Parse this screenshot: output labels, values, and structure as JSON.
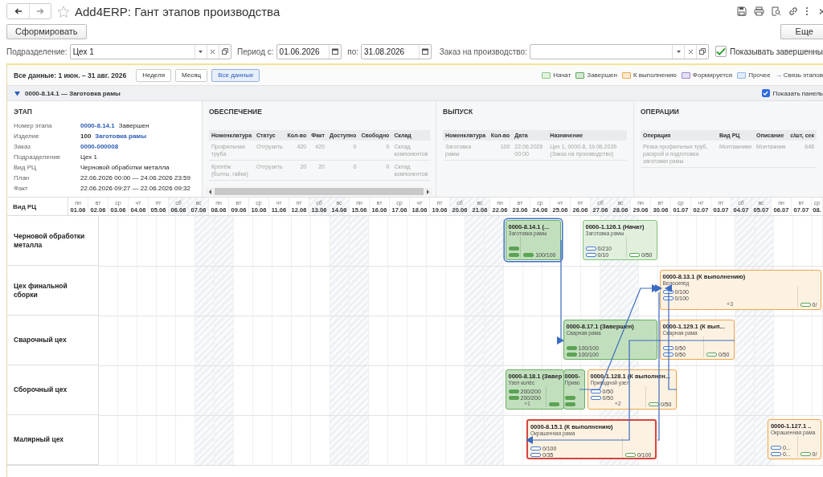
{
  "nav": {
    "title": "Add4ERP: Гант этапов производства",
    "favorite": false
  },
  "actions": {
    "generate": "Сформировать",
    "more": "Еще"
  },
  "filters": {
    "division_label": "Подразделение:",
    "division": "Цех 1",
    "period_from_label": "Период с:",
    "period_from": "01.06.2026",
    "period_to_label": "по:",
    "period_to": "31.08.2026",
    "order_label": "Заказ на производство:",
    "show_completed": {
      "label": "Показывать завершенны",
      "checked": true
    }
  },
  "toolbar": {
    "range": "Все данные: 1 июн. – 31 авг. 2026",
    "scales": [
      {
        "label": "Неделя",
        "selected": false
      },
      {
        "label": "Месяц",
        "selected": false
      },
      {
        "label": "Все данные",
        "selected": true
      }
    ],
    "legend": [
      {
        "label": "Начат",
        "color": "#8cc985"
      },
      {
        "label": "Завершен",
        "color": "#5fa85a"
      },
      {
        "label": "К выполнению",
        "color": "#f0a54a"
      },
      {
        "label": "Формируется",
        "color": "#9a85d0"
      },
      {
        "label": "Прочее",
        "color": "#8fb8e8"
      }
    ],
    "link_arrow": "→",
    "link_label": "Связь этапов"
  },
  "stage_header": {
    "title": "0000-8.14.1 — Заготовка рамы",
    "expanded": true,
    "show_panel": {
      "label": "Показать панель",
      "checked": true
    }
  },
  "details": {
    "stage": {
      "title": "ЭТАП",
      "fields": [
        {
          "label": "Номер этапа",
          "parts": [
            {
              "text": "0000-8.14.1",
              "kind": "link"
            },
            {
              "text": "Завершен",
              "kind": "plain"
            }
          ]
        },
        {
          "label": "Изделие",
          "parts": [
            {
              "text": "100",
              "kind": "bold"
            },
            {
              "text": "Заготовка рамы",
              "kind": "link"
            }
          ]
        },
        {
          "label": "Заказ",
          "parts": [
            {
              "text": "0000-000008",
              "kind": "link"
            }
          ]
        },
        {
          "label": "Подразделение",
          "parts": [
            {
              "text": "Цех 1",
              "kind": "plain"
            }
          ]
        },
        {
          "label": "Вид РЦ",
          "parts": [
            {
              "text": "Черновой обработки металла",
              "kind": "plain"
            }
          ]
        },
        {
          "label": "План",
          "parts": [
            {
              "text": "22.06.2026 00:00 — 24.06.2026 23:59",
              "kind": "plain"
            }
          ]
        },
        {
          "label": "Факт",
          "parts": [
            {
              "text": "22.06.2026 09:27 — 22.06.2026 09:32",
              "kind": "plain"
            }
          ]
        }
      ]
    },
    "supply": {
      "title": "ОБЕСПЕЧЕНИЕ",
      "columns": [
        {
          "label": "Номенклатура",
          "kind": "text"
        },
        {
          "label": "Статус",
          "kind": "text"
        },
        {
          "label": "Кол-во",
          "kind": "num"
        },
        {
          "label": "Факт",
          "kind": "num"
        },
        {
          "label": "Доступно",
          "kind": "num"
        },
        {
          "label": "Свободно",
          "kind": "num"
        },
        {
          "label": "Склад",
          "kind": "text"
        }
      ],
      "rows": [
        [
          "Профильная труба",
          "Отгрузить",
          "420",
          "420",
          "0",
          "0",
          "Склад компонентов"
        ],
        [
          "Крепёж (болты, гайки)",
          "Отгрузить",
          "20",
          "20",
          "0",
          "0",
          "Склад компонентов"
        ]
      ]
    },
    "output": {
      "title": "ВЫПУСК",
      "columns": [
        {
          "label": "Номенклатура",
          "kind": "text"
        },
        {
          "label": "Кол-во",
          "kind": "num"
        },
        {
          "label": "Дата",
          "kind": "text"
        },
        {
          "label": "Назначение",
          "kind": "text"
        }
      ],
      "rows": [
        [
          "Заготовка рамы",
          "100",
          "22.06.2026 00:00",
          "Цех 1, 0000-8, 19.06.2026 (Заказ на производство)"
        ]
      ]
    },
    "operations": {
      "title": "ОПЕРАЦИИ",
      "columns": [
        {
          "label": "Операция",
          "kind": "text"
        },
        {
          "label": "Вид РЦ",
          "kind": "text"
        },
        {
          "label": "Описание",
          "kind": "text"
        },
        {
          "label": "с/шт, сек",
          "kind": "num"
        }
      ],
      "rows": [
        [
          "Резка профильных труб, раскрой и подготовка заготовки рамы",
          "Монтажники",
          "Монтажник",
          "648"
        ]
      ]
    }
  },
  "gantt": {
    "row_header": "Вид РЦ",
    "days": [
      {
        "wd": "пн",
        "date": "01.06",
        "weekend": false
      },
      {
        "wd": "вт",
        "date": "02.06",
        "weekend": false
      },
      {
        "wd": "ср",
        "date": "03.06",
        "weekend": false
      },
      {
        "wd": "чт",
        "date": "04.06",
        "weekend": false
      },
      {
        "wd": "пт",
        "date": "05.06",
        "weekend": false
      },
      {
        "wd": "сб",
        "date": "06.06",
        "weekend": true
      },
      {
        "wd": "вс",
        "date": "07.06",
        "weekend": true
      },
      {
        "wd": "пн",
        "date": "08.06",
        "weekend": false
      },
      {
        "wd": "вт",
        "date": "09.06",
        "weekend": false
      },
      {
        "wd": "ср",
        "date": "10.06",
        "weekend": false
      },
      {
        "wd": "чт",
        "date": "11.06",
        "weekend": false
      },
      {
        "wd": "пт",
        "date": "12.06",
        "weekend": false
      },
      {
        "wd": "сб",
        "date": "13.06",
        "weekend": true
      },
      {
        "wd": "вс",
        "date": "14.06",
        "weekend": true
      },
      {
        "wd": "пн",
        "date": "15.06",
        "weekend": false
      },
      {
        "wd": "вт",
        "date": "16.06",
        "weekend": false
      },
      {
        "wd": "ср",
        "date": "17.06",
        "weekend": false
      },
      {
        "wd": "чт",
        "date": "18.06",
        "weekend": false
      },
      {
        "wd": "пт",
        "date": "19.06",
        "weekend": false
      },
      {
        "wd": "сб",
        "date": "20.06",
        "weekend": true
      },
      {
        "wd": "вс",
        "date": "21.06",
        "weekend": true
      },
      {
        "wd": "пн",
        "date": "22.06",
        "weekend": false
      },
      {
        "wd": "вт",
        "date": "23.06",
        "weekend": false
      },
      {
        "wd": "ср",
        "date": "24.06",
        "weekend": false
      },
      {
        "wd": "чт",
        "date": "25.06",
        "weekend": false
      },
      {
        "wd": "пт",
        "date": "26.06",
        "weekend": false
      },
      {
        "wd": "сб",
        "date": "27.06",
        "weekend": true
      },
      {
        "wd": "вс",
        "date": "28.06",
        "weekend": true
      },
      {
        "wd": "пн",
        "date": "29.06",
        "weekend": false
      },
      {
        "wd": "вт",
        "date": "30.06",
        "weekend": false
      },
      {
        "wd": "ср",
        "date": "01.07",
        "weekend": false
      },
      {
        "wd": "чт",
        "date": "02.07",
        "weekend": false
      },
      {
        "wd": "пт",
        "date": "03.07",
        "weekend": false
      },
      {
        "wd": "сб",
        "date": "04.07",
        "weekend": true
      },
      {
        "wd": "вс",
        "date": "05.07",
        "weekend": true
      },
      {
        "wd": "пн",
        "date": "06.07",
        "weekend": false
      },
      {
        "wd": "вт",
        "date": "07.07",
        "weekend": false
      },
      {
        "wd": "ср",
        "date": "08.",
        "weekend": false
      }
    ],
    "rows": [
      {
        "name": "Черновой обработки металла",
        "cards": [
          {
            "title": "0000-8.14.1 (...",
            "subtitle": "Заготовка рамы",
            "kind": "done",
            "selected": true,
            "alert": false,
            "bars": [
              {
                "filled": true
              },
              {
                "filled": true
              }
            ],
            "total": {
              "label": "100/100",
              "filled": true
            }
          },
          {
            "title": "0000-1.126.1 (Начат)",
            "subtitle": "Заготовка рамы",
            "kind": "started",
            "selected": false,
            "alert": false,
            "bars": [
              {
                "label": "0/210",
                "filled": false
              },
              {
                "label": "0/10",
                "filled": false
              }
            ],
            "total": {
              "label": "0/50",
              "filled": false
            }
          }
        ]
      },
      {
        "name": "Цех финальной сборки",
        "cards": [
          {
            "title": "0000-8.13.1 (К выполнению)",
            "subtitle": "Велосипед",
            "kind": "todo",
            "selected": false,
            "alert": false,
            "bars": [
              {
                "label": "0/100",
                "filled": false
              },
              {
                "label": "0/100",
                "filled": false
              }
            ],
            "extra": "+3",
            "total": {
              "label": "0/",
              "filled": false
            }
          }
        ]
      },
      {
        "name": "Сварочный цех",
        "cards": [
          {
            "title": "0000-8.17.1 (Завершен)",
            "subtitle": "Сварная рама",
            "kind": "done",
            "selected": false,
            "alert": false,
            "bars": [
              {
                "label": "100/100",
                "filled": true
              },
              {
                "label": "100/100",
                "filled": true
              }
            ]
          },
          {
            "title": "0000-1.129.1 (К вып...",
            "subtitle": "Сварная рама",
            "kind": "todo",
            "selected": false,
            "alert": false,
            "bars": [
              {
                "label": "0/50",
                "filled": false
              },
              {
                "label": "0/50",
                "filled": false
              }
            ],
            "total": {
              "label": "0/50",
              "filled": false
            }
          }
        ]
      },
      {
        "name": "Сборочный цех",
        "cards": [
          {
            "title": "0000-8.18.1 (Завер",
            "subtitle": "Узел колёс",
            "kind": "done",
            "selected": false,
            "alert": false,
            "bars": [
              {
                "label": "200/200",
                "filled": true
              },
              {
                "label": "200/200",
                "filled": true
              }
            ],
            "extra": "+1",
            "total": {
              "filled": true
            }
          },
          {
            "title": "0000-",
            "subtitle": "Приво",
            "kind": "done",
            "selected": false,
            "alert": false,
            "bars": [
              {
                "filled": true
              },
              {
                "filled": true
              }
            ]
          },
          {
            "title": "0000-1.128.1 (К выполнен...",
            "subtitle": "Приводной узел",
            "kind": "todo",
            "selected": false,
            "alert": false,
            "bars": [
              {
                "label": "0/50",
                "filled": false
              },
              {
                "label": "0/50",
                "filled": false
              }
            ],
            "extra": "+2",
            "total": {
              "label": "0/50",
              "filled": false
            }
          }
        ]
      },
      {
        "name": "Малярный цех",
        "cards": [
          {
            "title": "0000-8.15.1 (К выполнению)",
            "subtitle": "Окрашенная рама",
            "kind": "todo",
            "selected": false,
            "alert": true,
            "bars": [
              {
                "label": "0/100",
                "filled": false
              },
              {
                "label": "0/35",
                "filled": false
              }
            ],
            "total": {
              "label": "0/100",
              "filled": false
            }
          },
          {
            "title": "0000-1.127.1 ..",
            "subtitle": "Окрашенная рама",
            "kind": "todo",
            "selected": false,
            "alert": false,
            "bars": [
              {
                "label": "0...",
                "filled": false
              },
              {
                "label": "0...",
                "filled": false
              }
            ],
            "total": {
              "label": "0/",
              "filled": false
            }
          }
        ]
      }
    ]
  }
}
